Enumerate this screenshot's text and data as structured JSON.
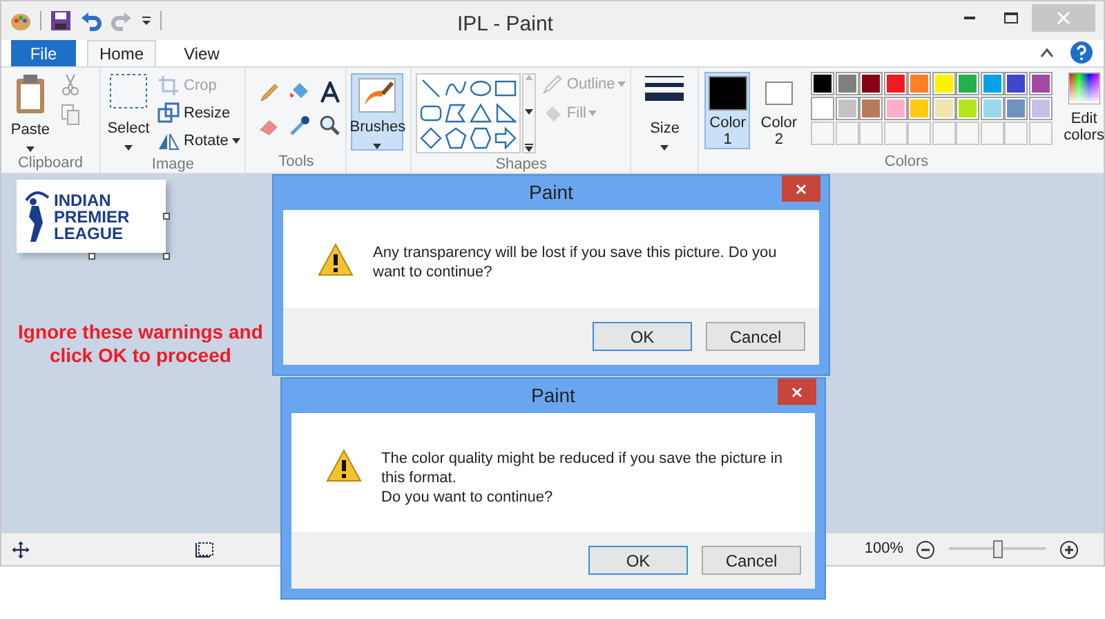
{
  "window": {
    "title": "IPL - Paint"
  },
  "tabs": [
    {
      "label": "File",
      "kind": "file",
      "selected": false
    },
    {
      "label": "Home",
      "kind": "tab",
      "selected": true
    },
    {
      "label": "View",
      "kind": "tab",
      "selected": false
    }
  ],
  "ribbon": {
    "clipboard": {
      "label": "Clipboard",
      "paste": "Paste"
    },
    "image": {
      "label": "Image",
      "select": "Select",
      "items": [
        {
          "label": "Crop",
          "disabled": true
        },
        {
          "label": "Resize",
          "disabled": false
        },
        {
          "label": "Rotate",
          "disabled": false
        }
      ]
    },
    "tools": {
      "label": "Tools"
    },
    "brushes": {
      "label": "Brushes",
      "selected": true
    },
    "shapes": {
      "label": "Shapes",
      "outline": {
        "label": "Outline",
        "disabled": true
      },
      "fill": {
        "label": "Fill",
        "disabled": true
      }
    },
    "size": {
      "label": "Size"
    },
    "colors": {
      "label": "Colors",
      "color_1": {
        "label": "Color",
        "number": "1",
        "color": "#000000",
        "selected": true
      },
      "color_2": {
        "label": "Color",
        "number": "2",
        "color": "#ffffff",
        "selected": false
      },
      "palette": [
        {
          "color": "#000000"
        },
        {
          "color": "#7f7f7f"
        },
        {
          "color": "#880015"
        },
        {
          "color": "#ed1c24"
        },
        {
          "color": "#ff7f27"
        },
        {
          "color": "#fff200"
        },
        {
          "color": "#22b14c"
        },
        {
          "color": "#00a2e8"
        },
        {
          "color": "#3f48cc"
        },
        {
          "color": "#a349a4"
        },
        {
          "color": "#ffffff"
        },
        {
          "color": "#c3c3c3"
        },
        {
          "color": "#b97a57"
        },
        {
          "color": "#ffaec9"
        },
        {
          "color": "#ffc90e"
        },
        {
          "color": "#efe4b0"
        },
        {
          "color": "#b5e61d"
        },
        {
          "color": "#99d9ea"
        },
        {
          "color": "#7092be"
        },
        {
          "color": "#c8bfe7"
        }
      ],
      "edit_colors": "Edit colors"
    }
  },
  "canvas": {
    "logo_lines": [
      "INDIAN",
      "PREMIER",
      "LEAGUE"
    ],
    "note": [
      "Ignore these warnings and",
      "click OK to proceed"
    ]
  },
  "dialogs": [
    {
      "title": "Paint",
      "message": [
        "Any transparency will be lost if you save this picture. Do you want to continue?"
      ],
      "buttons": [
        {
          "label": "OK",
          "selected": true
        },
        {
          "label": "Cancel",
          "selected": false
        }
      ]
    },
    {
      "title": "Paint",
      "message": [
        "The color quality might be reduced if you save the picture in this format.",
        "Do you want to continue?"
      ],
      "buttons": [
        {
          "label": "OK",
          "selected": true
        },
        {
          "label": "Cancel",
          "selected": false
        }
      ]
    }
  ],
  "status_bar": {
    "zoom": "100%",
    "zoom_slider": {
      "level": 0.5
    }
  }
}
